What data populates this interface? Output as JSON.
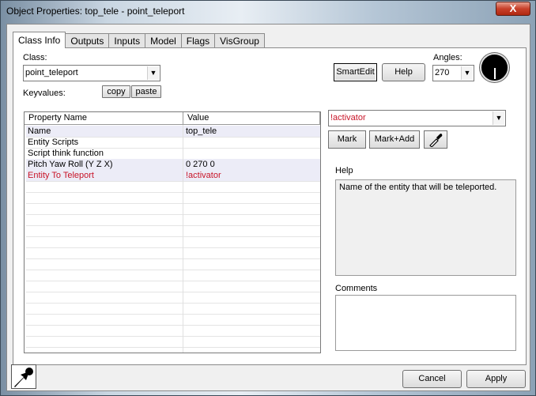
{
  "window": {
    "title": "Object Properties: top_tele - point_teleport",
    "close_glyph": "X"
  },
  "tabs": [
    {
      "label": "Class Info",
      "active": true
    },
    {
      "label": "Outputs"
    },
    {
      "label": "Inputs"
    },
    {
      "label": "Model"
    },
    {
      "label": "Flags"
    },
    {
      "label": "VisGroup"
    }
  ],
  "classinfo": {
    "class_label": "Class:",
    "class_value": "point_teleport",
    "keyvalues_label": "Keyvalues:",
    "copy_label": "copy",
    "paste_label": "paste",
    "smartedit_label": "SmartEdit",
    "help_label": "Help",
    "angles_label": "Angles:",
    "angles_value": "270"
  },
  "grid": {
    "columns": [
      "Property Name",
      "Value"
    ],
    "rows": [
      {
        "name": "Name",
        "value": "top_tele"
      },
      {
        "name": "Entity Scripts",
        "value": ""
      },
      {
        "name": "Script think function",
        "value": ""
      },
      {
        "name": "Pitch Yaw Roll (Y Z X)",
        "value": "0 270 0"
      },
      {
        "name": "Entity To Teleport",
        "value": "!activator"
      }
    ]
  },
  "value_editor": {
    "value": "!activator",
    "mark_label": "Mark",
    "markadd_label": "Mark+Add"
  },
  "help": {
    "label": "Help",
    "text": "Name of the entity that will be teleported."
  },
  "comments": {
    "label": "Comments"
  },
  "footer": {
    "cancel_label": "Cancel",
    "apply_label": "Apply"
  },
  "colors": {
    "highlight_text": "#c81428"
  },
  "icons": {
    "eyedropper": "eyedropper-icon",
    "pointer": "pointer-icon",
    "angle_dial": "angle-dial-icon"
  }
}
